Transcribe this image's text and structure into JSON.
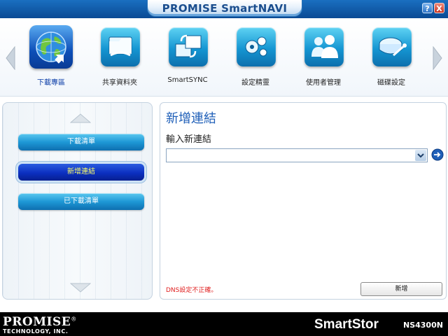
{
  "window": {
    "title": "PROMISE SmartNAVI",
    "help_button": "?",
    "close_button": "X"
  },
  "nav": {
    "items": [
      {
        "label": "下載專區",
        "icon": "globe-download-icon",
        "active": true
      },
      {
        "label": "共享資料夾",
        "icon": "shared-folder-icon",
        "active": false
      },
      {
        "label": "SmartSYNC",
        "icon": "sync-icon",
        "active": false
      },
      {
        "label": "設定精靈",
        "icon": "wizard-icon",
        "active": false
      },
      {
        "label": "使用者管理",
        "icon": "user-management-icon",
        "active": false
      },
      {
        "label": "磁碟設定",
        "icon": "disk-settings-icon",
        "active": false
      }
    ]
  },
  "sidebar": {
    "items": [
      {
        "label": "下載清單",
        "selected": false
      },
      {
        "label": "新增連結",
        "selected": true
      },
      {
        "label": "已下載清單",
        "selected": false
      }
    ]
  },
  "main": {
    "title": "新增連結",
    "field_label": "輸入新連結",
    "url_value": "",
    "error": "DNS設定不正確。",
    "add_button": "新增"
  },
  "footer": {
    "brand": "PROMISE",
    "brand_mark": "®",
    "brand_sub": "TECHNOLOGY, INC.",
    "product": "SmartStor",
    "model": "NS4300N"
  },
  "colors": {
    "accent_blue": "#1f5fb8",
    "error_red": "#e02020",
    "selected_text": "#ffff66"
  }
}
